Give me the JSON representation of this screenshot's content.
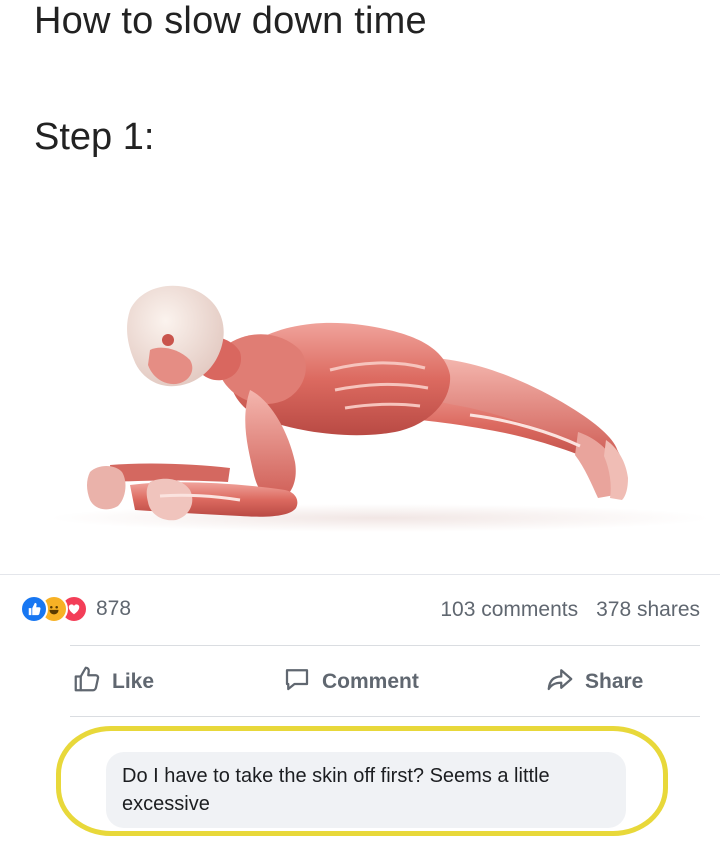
{
  "meme": {
    "title": "How to slow down time",
    "step": "Step 1:"
  },
  "post": {
    "reaction_count": "878",
    "reactions": [
      "like-reaction-icon",
      "haha-reaction-icon",
      "love-reaction-icon"
    ],
    "comments": "103 comments",
    "shares": "378 shares",
    "actions": {
      "like": "Like",
      "comment": "Comment",
      "share": "Share"
    }
  },
  "comment": {
    "text": "Do I have to take the skin off first? Seems a little excessive"
  },
  "colors": {
    "like_blue": "#1877f2",
    "haha_yellow": "#f7b125",
    "love_red": "#f33e58",
    "highlight_yellow": "#e8d83a",
    "muscle_red": "#d9675f"
  }
}
